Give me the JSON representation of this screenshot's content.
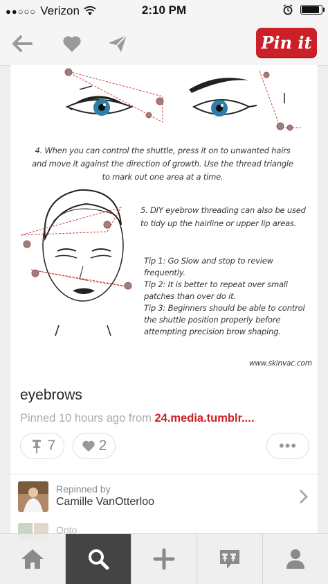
{
  "status_bar": {
    "signal": "●●○○○",
    "carrier": "Verizon",
    "time": "2:10 PM",
    "battery_level": 0.9
  },
  "top_bar": {
    "back_icon": "back-arrow-icon",
    "like_icon": "heart-icon",
    "send_icon": "send-icon",
    "pinit_label": "Pin it"
  },
  "pin_image": {
    "step4": "4. When you can control the shuttle, press it on to unwanted hairs and move it against the direction of growth. Use the thread triangle to mark out one area at a time.",
    "step5": "5. DIY eyebrow threading can also be used to tidy up the hairline or upper lip areas.",
    "tip1": "Tip 1: Go Slow and stop to review frequently.",
    "tip2": "Tip 2: It is better to repeat over small patches than over do it.",
    "tip3": "Tip 3: Beginners should be able to control the shuttle position properly before attempting precision brow shaping.",
    "credit": "www.skinvac.com"
  },
  "pin": {
    "title": "eyebrows",
    "source_prefix": "Pinned 10 hours ago from ",
    "source_link": "24.media.tumblr....",
    "repin_count": "7",
    "like_count": "2",
    "more_label": "•••"
  },
  "repinned": {
    "label": "Repinned by",
    "name": "Camille VanOtterloo"
  },
  "onto": {
    "label": "Onto"
  },
  "tabs": [
    {
      "name": "home",
      "icon": "home-icon"
    },
    {
      "name": "search",
      "icon": "search-icon"
    },
    {
      "name": "add",
      "icon": "plus-icon"
    },
    {
      "name": "news",
      "icon": "news-icon"
    },
    {
      "name": "profile",
      "icon": "person-icon"
    }
  ],
  "colors": {
    "brand_red": "#cb2027",
    "active_tab": "#444444"
  }
}
